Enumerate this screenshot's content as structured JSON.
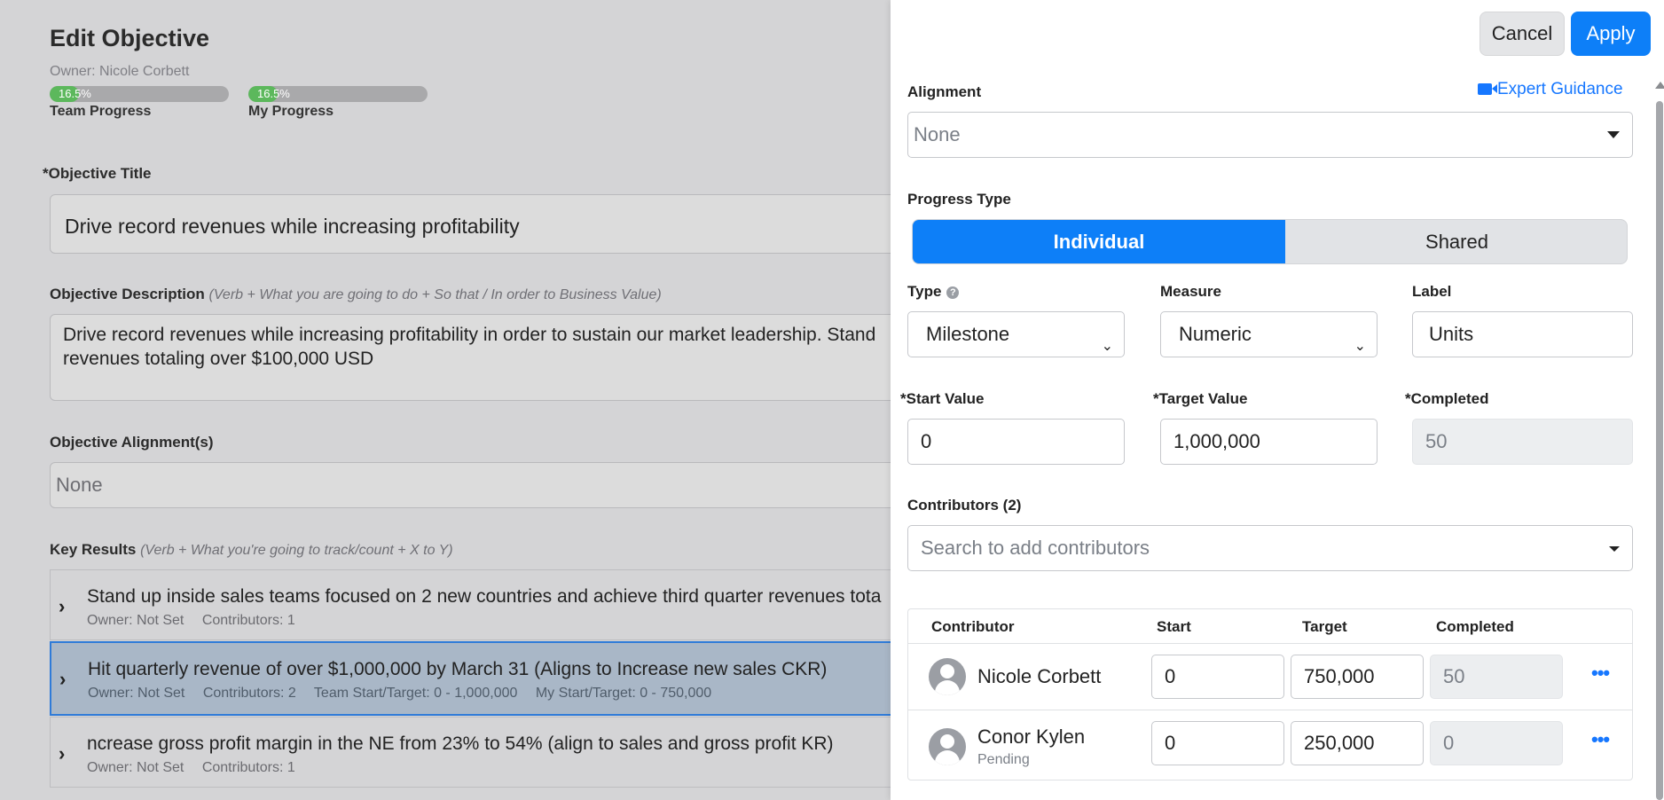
{
  "page": {
    "title": "Edit Objective",
    "owner": "Owner: Nicole Corbett",
    "team_progress": {
      "label": "Team Progress",
      "value": "16.5%",
      "fraction": 0.165
    },
    "my_progress": {
      "label": "My Progress",
      "value": "16.5%",
      "fraction": 0.165
    },
    "objective_title_label": "*Objective Title",
    "objective_title_value": "Drive record revenues while increasing profitability",
    "description_label": "Objective Description",
    "description_hint": "(Verb + What you are going to do + So that / In order to Business Value)",
    "description_line1": "Drive record revenues while increasing profitability in order to sustain our market leadership. Stand",
    "description_line2": "revenues totaling over $100,000 USD",
    "alignment_label": "Objective Alignment(s)",
    "alignment_value": "None",
    "key_results_label": "Key Results",
    "key_results_hint": "(Verb + What you're going to track/count + X to Y)",
    "key_results": [
      {
        "title": "Stand up inside sales teams focused on 2 new countries and achieve third quarter revenues tota",
        "meta": [
          "Owner: Not Set",
          "Contributors: 1"
        ]
      },
      {
        "title": "Hit quarterly revenue of over $1,000,000 by March 31 (Aligns to Increase new sales CKR)",
        "meta": [
          "Owner: Not Set",
          "Contributors: 2",
          "Team Start/Target: 0 - 1,000,000",
          "My Start/Target: 0 - 750,000"
        ]
      },
      {
        "title": "ncrease gross profit margin in the NE from 23% to 54% (align to sales and gross profit KR)",
        "meta": [
          "Owner: Not Set",
          "Contributors: 1"
        ]
      }
    ]
  },
  "drawer": {
    "cancel_label": "Cancel",
    "apply_label": "Apply",
    "alignment_label": "Alignment",
    "expert_guidance": "Expert Guidance",
    "alignment_value": "None",
    "progress_type_label": "Progress Type",
    "progress_types": [
      "Individual",
      "Shared"
    ],
    "progress_type_selected": "Individual",
    "type_label": "Type",
    "type_value": "Milestone",
    "measure_label": "Measure",
    "measure_value": "Numeric",
    "label_label": "Label",
    "label_value": "Units",
    "start_label": "*Start Value",
    "start_value": "0",
    "target_label": "*Target Value",
    "target_value": "1,000,000",
    "completed_label": "*Completed",
    "completed_value": "50",
    "contributors_label": "Contributors (2)",
    "contributors_placeholder": "Search to add contributors",
    "table_headers": [
      "Contributor",
      "Start",
      "Target",
      "Completed"
    ],
    "contributors": [
      {
        "name": "Nicole Corbett",
        "status": "",
        "start": "0",
        "target": "750,000",
        "completed": "50"
      },
      {
        "name": "Conor Kylen",
        "status": "Pending",
        "start": "0",
        "target": "250,000",
        "completed": "0"
      }
    ],
    "colors": {
      "primary": "#0d7ff8",
      "progress_fill": "#5cb85c",
      "selected_row": "#a9b7c7"
    },
    "icons": [
      "video-camera-icon",
      "help-circle-icon",
      "caret-down-icon",
      "chevron-down-icon",
      "more-dots-icon",
      "user-avatar-icon",
      "chevron-right-icon"
    ]
  }
}
